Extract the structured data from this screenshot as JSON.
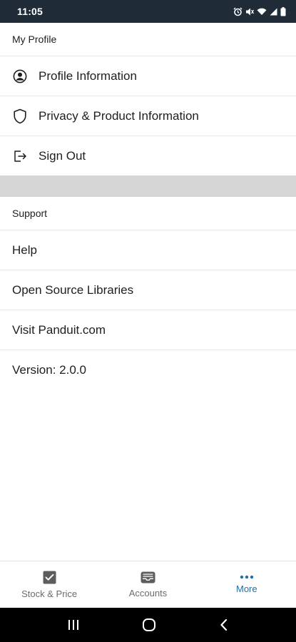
{
  "status_bar": {
    "time": "11:05",
    "icons": [
      "alarm-icon",
      "mute-icon",
      "wifi-icon",
      "signal-icon",
      "battery-icon"
    ]
  },
  "my_profile": {
    "header": "My Profile",
    "items": [
      {
        "label": "Profile Information",
        "icon": "user-circle-icon"
      },
      {
        "label": "Privacy & Product Information",
        "icon": "shield-icon"
      },
      {
        "label": "Sign Out",
        "icon": "sign-out-icon"
      }
    ]
  },
  "support": {
    "header": "Support",
    "items": [
      {
        "label": "Help"
      },
      {
        "label": "Open Source Libraries"
      },
      {
        "label": "Visit Panduit.com"
      }
    ],
    "version": "Version: 2.0.0"
  },
  "bottom_nav": {
    "items": [
      {
        "label": "Stock & Price",
        "icon": "checkbox-icon",
        "active": false
      },
      {
        "label": "Accounts",
        "icon": "inbox-tray-icon",
        "active": false
      },
      {
        "label": "More",
        "icon": "more-dots-icon",
        "active": true
      }
    ]
  },
  "colors": {
    "status_bar_bg": "#1f2c38",
    "active_accent": "#1f6fa8",
    "divider_band": "#d6d6d6"
  }
}
